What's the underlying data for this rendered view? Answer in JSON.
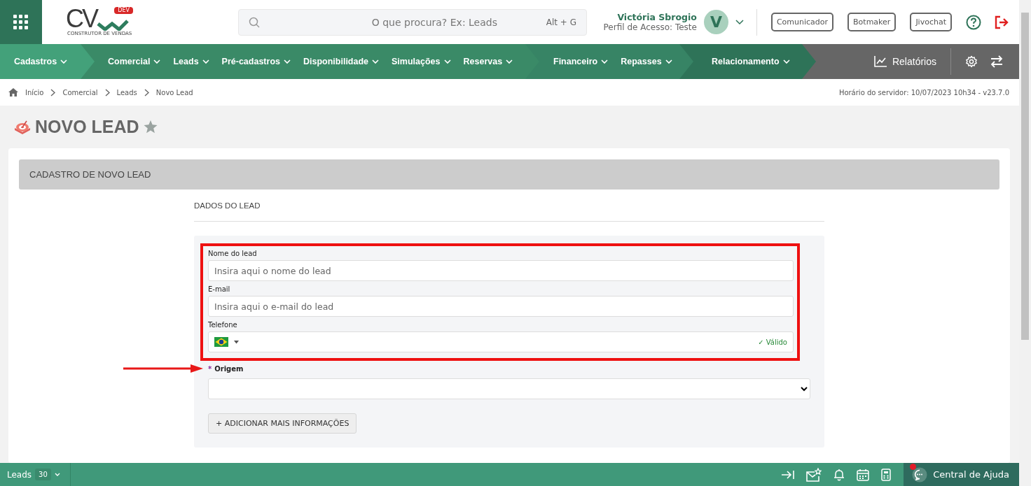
{
  "header": {
    "logo": {
      "letters": "CV",
      "badge": "DEV",
      "tagline": "CONSTRUTOR DE VENDAS"
    },
    "search": {
      "placeholder": "O que procura? Ex: Leads",
      "shortcut": "Alt + G"
    },
    "user": {
      "name": "Victória Sbrogio",
      "profile": "Perfil de Acesso: Teste",
      "initial": "V"
    },
    "buttons": [
      "Comunicador",
      "Botmaker",
      "Jivochat"
    ]
  },
  "nav": {
    "groups": [
      [
        "Cadastros"
      ],
      [
        "Comercial",
        "Leads",
        "Pré-cadastros",
        "Disponibilidade",
        "Simulações",
        "Reservas"
      ],
      [
        "Financeiro",
        "Repasses"
      ],
      [
        "Relacionamento"
      ]
    ],
    "reports": "Relatórios"
  },
  "breadcrumb": {
    "items": [
      "Início",
      "Comercial",
      "Leads",
      "Novo Lead"
    ],
    "server_time": "Horário do servidor: 10/07/2023 10h34 - v23.7.0"
  },
  "page": {
    "title": "NOVO LEAD",
    "favorite": false,
    "section": "CADASTRO DE NOVO LEAD",
    "subsection": "DADOS DO LEAD",
    "fields": [
      {
        "kind": "text",
        "label": "Nome do lead",
        "placeholder": "Insira aqui o nome do lead",
        "highlighted": true
      },
      {
        "kind": "text",
        "label": "E-mail",
        "placeholder": "Insira aqui o e-mail do lead",
        "highlighted": true
      },
      {
        "kind": "phone",
        "label": "Telefone",
        "status": "✓ Válido",
        "highlighted": true
      },
      {
        "kind": "select",
        "label": "Origem",
        "required_mark": "*",
        "highlighted": false
      }
    ],
    "more_button": "+ ADICIONAR MAIS INFORMAÇÕES"
  },
  "bottom_bar": {
    "label": "Leads",
    "count": "30",
    "help": "Central de Ajuda",
    "help_notification": true
  }
}
